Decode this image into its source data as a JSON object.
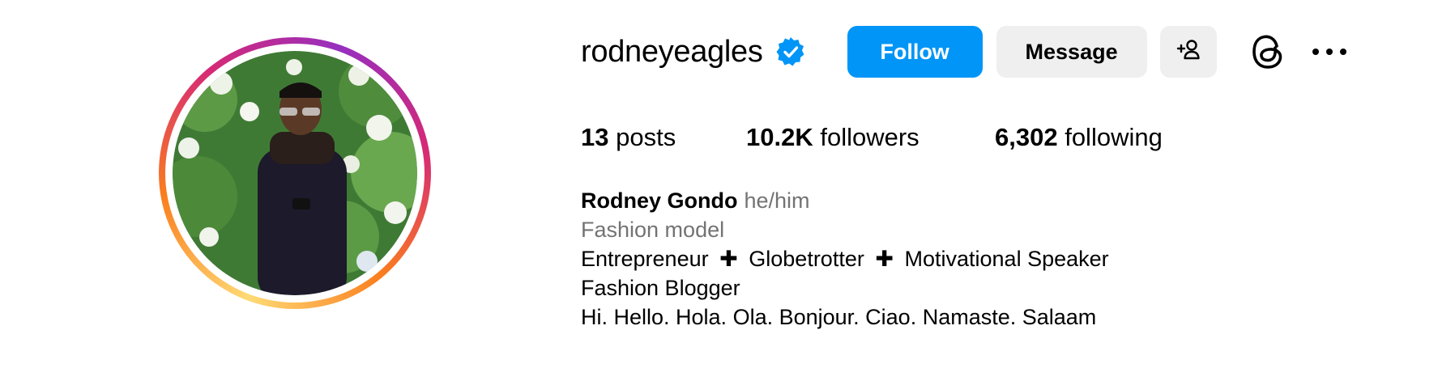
{
  "profile": {
    "username": "rodneyeagles",
    "verified": true,
    "full_name": "Rodney Gondo",
    "pronouns": "he/him",
    "category": "Fashion model",
    "bio_lines": {
      "line1_parts": [
        "Entrepreneur",
        "Globetrotter",
        "Motivational Speaker"
      ],
      "separator": "✚",
      "line2": "Fashion Blogger",
      "line3": "Hi. Hello. Hola. Ola. Bonjour. Ciao. Namaste. Salaam"
    },
    "avatar_alt": "Profile photo of rodneyeagles",
    "story_ring": true
  },
  "actions": {
    "follow_label": "Follow",
    "message_label": "Message",
    "add_user_icon": "add-person-icon",
    "threads_icon": "threads-icon",
    "more_icon": "more-options-icon"
  },
  "stats": {
    "posts": {
      "count": "13",
      "label": "posts"
    },
    "followers": {
      "count": "10.2K",
      "label": "followers"
    },
    "following": {
      "count": "6,302",
      "label": "following"
    }
  },
  "colors": {
    "primary_button": "#0095f6",
    "secondary_button": "#efefef",
    "verified_badge": "#0095f6",
    "muted_text": "#737373"
  }
}
